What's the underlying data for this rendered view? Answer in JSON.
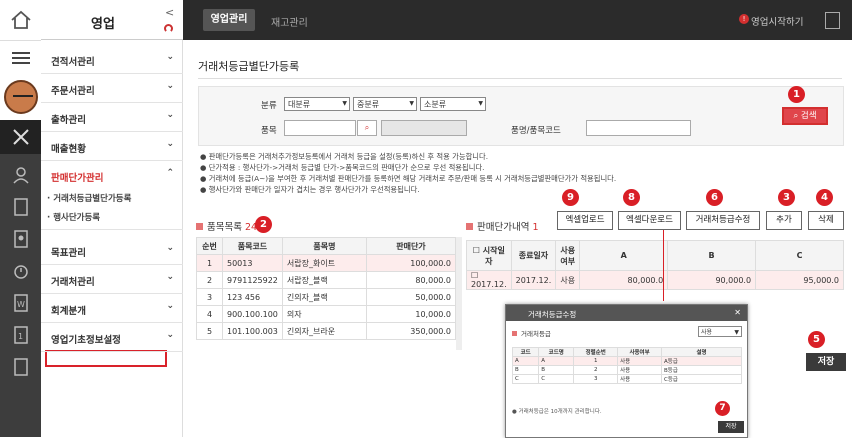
{
  "sidebar": {
    "title": "영업",
    "items": [
      {
        "label": "견적서관리"
      },
      {
        "label": "주문서관리"
      },
      {
        "label": "출하관리"
      },
      {
        "label": "매출현황"
      },
      {
        "label": "판매단가관리"
      },
      {
        "label": "목표관리"
      },
      {
        "label": "거래처관리"
      },
      {
        "label": "회계분개"
      },
      {
        "label": "영업기초정보설정"
      }
    ],
    "subitems": [
      {
        "label": "거래처등급별단가등록"
      },
      {
        "label": "행사단가등록"
      }
    ]
  },
  "topbar": {
    "tab_active": "영업관리",
    "tab_inactive": "재고관리",
    "start_label": "영업시작하기"
  },
  "page": {
    "title": "거래처등급별단가등록"
  },
  "filter": {
    "category_label": "분류",
    "category_large": "대분류",
    "category_mid": "중분류",
    "category_small": "소분류",
    "item_label": "품목",
    "item_name_label": "품명/품목코드",
    "search_label": "검색"
  },
  "notes": [
    "판매단가등록은 거래처추가정보등록에서 거래처 등급을 설정(등록)하신 후 적용 가능합니다.",
    "단가적용 : 행사단가->거래처 등급별 단가->품목코드의 판매단가 순으로 우선 적용됩니다.",
    "거래처에 등급(A~)을 부여한 후 거래처별 판매단가를 등록하면 해당 거래처로 주문/판매 등록 시 거래처등급별판매단가가 적용됩니다.",
    "행사단가와 판매단가 일자가 겹치는 경우 행사단가가 우선적용됩니다."
  ],
  "left_grid": {
    "title": "품목목록",
    "count": "24",
    "headers": [
      "순번",
      "품목코드",
      "품목명",
      "판매단가"
    ],
    "rows": [
      [
        "1",
        "50013",
        "서랍장_화이트",
        "100,000.0"
      ],
      [
        "2",
        "9791125922",
        "서랍장_블랙",
        "80,000.0"
      ],
      [
        "3",
        "123 456",
        "긴의자_블랙",
        "50,000.0"
      ],
      [
        "4",
        "900.100.100",
        "의자",
        "10,000.0"
      ],
      [
        "5",
        "101.100.003",
        "긴의자_브라운",
        "350,000.0"
      ]
    ]
  },
  "right_grid": {
    "title": "판매단가내역",
    "count": "1",
    "headers": [
      "시작일자",
      "종료일자",
      "사용여부",
      "A",
      "B",
      "C"
    ],
    "rows": [
      [
        "2017.12.",
        "2017.12.",
        "사용",
        "80,000.0",
        "90,000.0",
        "95,000.0"
      ]
    ]
  },
  "buttons": {
    "excel_upload": "엑셀업로드",
    "excel_download": "엑셀다운로드",
    "grade_edit": "거래처등급수정",
    "add": "추가",
    "delete": "삭제",
    "save": "저장"
  },
  "badges": [
    "1",
    "2",
    "3",
    "4",
    "5",
    "6",
    "7",
    "8",
    "9"
  ],
  "modal": {
    "title": "거래처등급수정",
    "section": "거래처등급",
    "filter_value": "사용",
    "headers": [
      "코드",
      "코드명",
      "정렬순번",
      "사용여부",
      "설명"
    ],
    "rows": [
      [
        "A",
        "A",
        "1",
        "사용",
        "A등급"
      ],
      [
        "B",
        "B",
        "2",
        "사용",
        "B등급"
      ],
      [
        "C",
        "C",
        "3",
        "사용",
        "C등급"
      ]
    ],
    "note": "거래처등급은 10개까지 관리합니다.",
    "save": "저장"
  },
  "colors": {
    "accent": "#d91f26",
    "dark": "#2b2b2b"
  }
}
